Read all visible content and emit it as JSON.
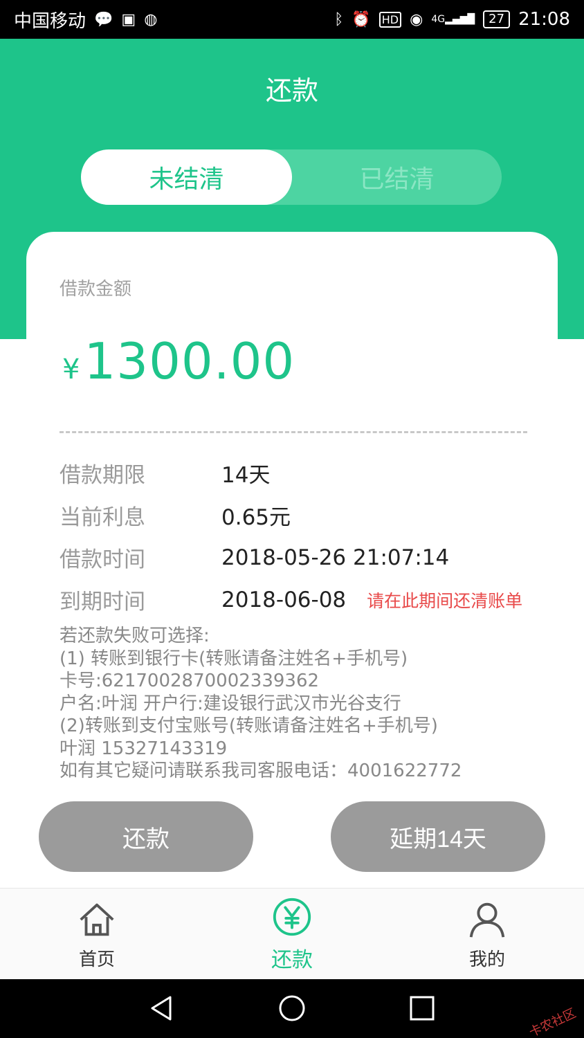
{
  "statusbar": {
    "carrier": "中国移动",
    "network": "4G",
    "battery": "27",
    "time": "21:08"
  },
  "header": {
    "title": "还款"
  },
  "segment": {
    "active": "未结清",
    "inactive": "已结清"
  },
  "loan": {
    "amount_label": "借款金额",
    "currency": "¥",
    "amount": "1300.00",
    "rows": [
      {
        "key": "借款期限",
        "value": "14天"
      },
      {
        "key": "当前利息",
        "value": "0.65元"
      },
      {
        "key": "借款时间",
        "value": "2018-05-26 21:07:14"
      },
      {
        "key": "到期时间",
        "value": "2018-06-08",
        "hint": "请在此期间还清账单"
      }
    ],
    "notes": [
      "若还款失败可选择:",
      "(1) 转账到银行卡(转账请备注姓名+手机号)",
      "卡号:6217002870002339362",
      "户名:叶润 开户行:建设银行武汉市光谷支行",
      "(2)转账到支付宝账号(转账请备注姓名+手机号)",
      "叶润 15327143319",
      "如有其它疑问请联系我司客服电话：4001622772"
    ]
  },
  "actions": {
    "repay": "还款",
    "extend": "延期14天"
  },
  "tabs": [
    {
      "label": "首页",
      "icon": "home-icon"
    },
    {
      "label": "还款",
      "icon": "yen-circle-icon"
    },
    {
      "label": "我的",
      "icon": "user-icon"
    }
  ],
  "colors": {
    "brand": "#1ec48a",
    "button_gray": "#9b9b9b",
    "hint_red": "#e84a4a"
  },
  "watermark": "卡农社区"
}
